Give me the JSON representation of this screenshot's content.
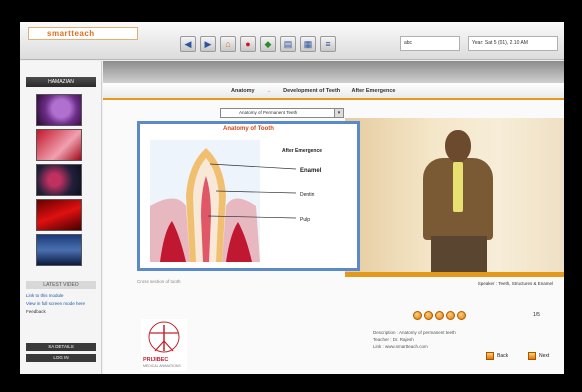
{
  "brand": {
    "name": "smartteach"
  },
  "toolbar": {
    "buttons": [
      {
        "icon": "arrow-left-icon",
        "glyph": "◀"
      },
      {
        "icon": "arrow-right-icon",
        "glyph": "▶"
      },
      {
        "icon": "home-icon",
        "glyph": "⌂"
      },
      {
        "icon": "record-icon",
        "glyph": "●"
      },
      {
        "icon": "bookmark-icon",
        "glyph": "◆"
      },
      {
        "icon": "print-icon",
        "glyph": "▤"
      },
      {
        "icon": "grid-icon",
        "glyph": "▦"
      },
      {
        "icon": "list-icon",
        "glyph": "≡"
      }
    ],
    "field1": "abc",
    "field2": "Year: Sat 5 (01), 2.10 AM"
  },
  "sidebar": {
    "header": "HAMAZIAN",
    "section_label": "LATEST VIDEO",
    "links": [
      "Link to this module",
      "View in full screen mode here",
      "Feedback"
    ],
    "footer": [
      "SA DETAILS",
      "LOG IN"
    ]
  },
  "main": {
    "breadcrumbs": [
      "Anatomy",
      "Development of Teeth",
      "After Emergence"
    ],
    "breadcrumb_sep": "→",
    "select_value": "Anatomy of Permanent Teeth",
    "anatomy": {
      "title": "Anatomy of Tooth",
      "subtitle": "After Emergence",
      "labels": {
        "enamel": "Enamel",
        "dentin": "Dentin",
        "pulp": "Pulp"
      }
    },
    "diagram_caption": "Cross section of tooth",
    "video_caption": "Speaker : Teeth, Structures & Enamel",
    "pager_count": "1/5",
    "meta_lines": [
      "Description : Anatomy of permanent teeth",
      "Teacher : Dr. Rajesh",
      "Link : www.smartteach.com"
    ],
    "logo_name": "PRIJIBEC",
    "logo_sub": "MEDICAL ANIMATIONS",
    "nav": {
      "prev": "Back",
      "next": "Next"
    }
  },
  "colors": {
    "accent": "#e39a1c",
    "frame_border": "#5b8acb",
    "title_red": "#d04a1a"
  }
}
